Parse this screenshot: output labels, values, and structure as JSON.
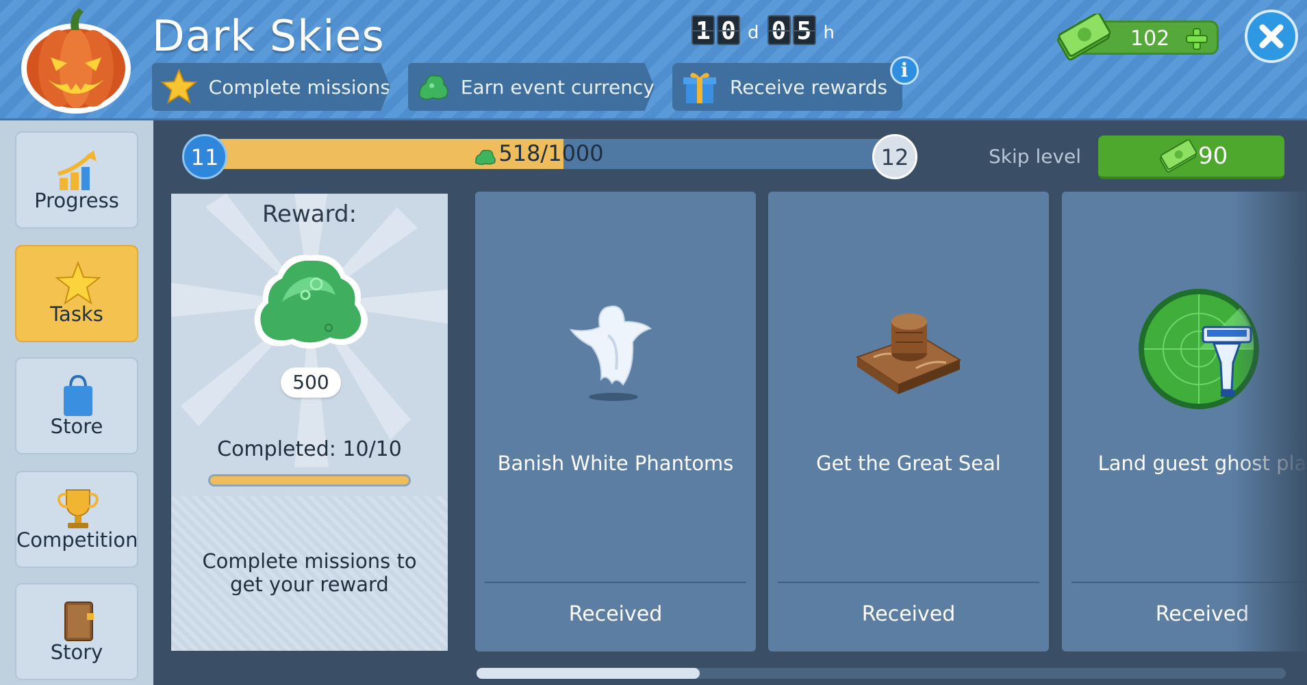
{
  "header": {
    "title": "Dark Skies",
    "steps": [
      {
        "label": "Complete missions",
        "icon": "star-icon"
      },
      {
        "label": "Earn event currency",
        "icon": "slime-icon"
      },
      {
        "label": "Receive rewards",
        "icon": "gift-icon"
      }
    ],
    "timer": {
      "days": [
        "1",
        "0"
      ],
      "day_unit": "d",
      "hours": [
        "0",
        "5"
      ],
      "hour_unit": "h"
    },
    "currency": "102"
  },
  "sidebar": {
    "items": [
      {
        "label": "Progress"
      },
      {
        "label": "Tasks"
      },
      {
        "label": "Store"
      },
      {
        "label": "Competition"
      },
      {
        "label": "Story"
      }
    ]
  },
  "level": {
    "current": "11",
    "next": "12",
    "progress_text": "518/1000",
    "progress_fraction": 0.518,
    "skip_label": "Skip level",
    "skip_cost": "90"
  },
  "reward": {
    "title": "Reward:",
    "amount": "500",
    "completed": "Completed: 10/10",
    "completed_fraction": 1.0,
    "hint": "Complete missions to get your reward"
  },
  "tasks": [
    {
      "title": "Banish White Phantoms",
      "status": "Received",
      "icon": "ghost-icon"
    },
    {
      "title": "Get the Great Seal",
      "status": "Received",
      "icon": "seal-icon"
    },
    {
      "title": "Land guest ghost pla",
      "status": "Received",
      "icon": "radar-icon"
    }
  ],
  "colors": {
    "accent_green": "#4ea82e",
    "progress_gold": "#efbd5b",
    "active_tab": "#f4c24e"
  }
}
